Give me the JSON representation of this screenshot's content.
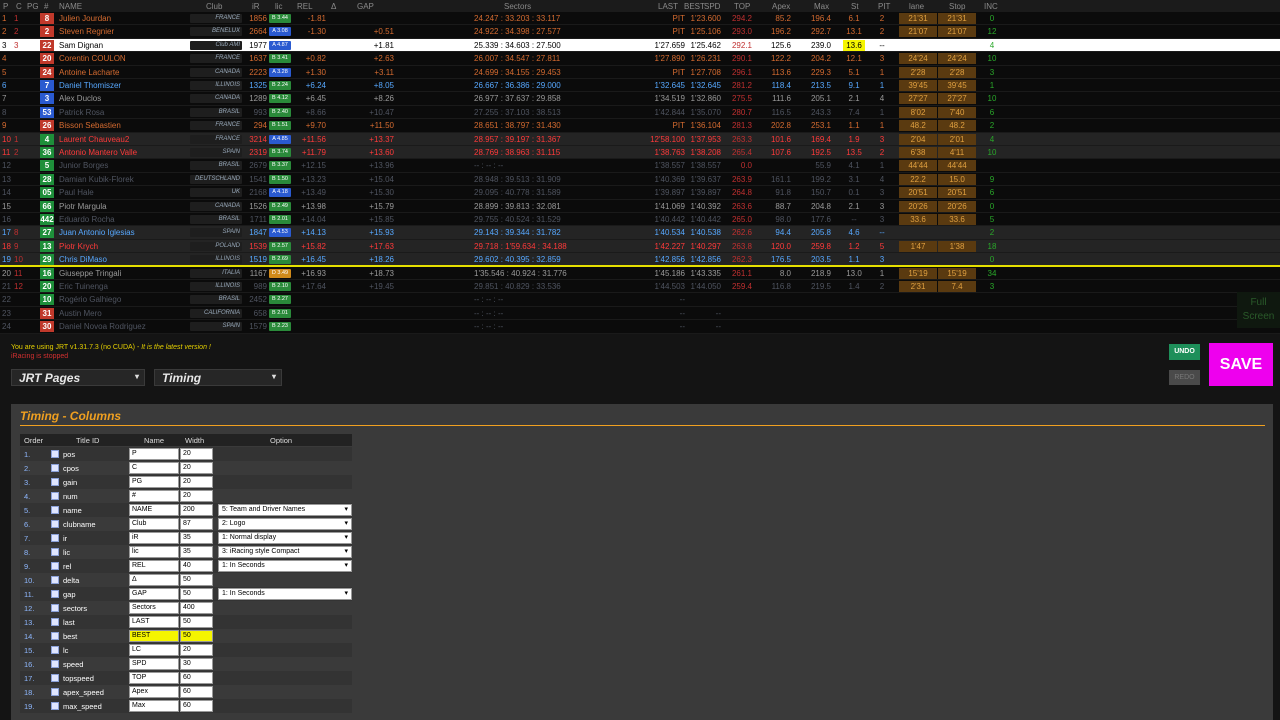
{
  "timing": {
    "headers": {
      "p": "P",
      "c": "C",
      "pg": "PG",
      "num": "#",
      "name": "NAME",
      "club": "Club",
      "ir": "iR",
      "lic": "lic",
      "rel": "REL",
      "delta": "Δ",
      "gap": "GAP",
      "sectors": "Sectors",
      "last": "LAST",
      "best": "BEST",
      "spd": "SPD",
      "top": "TOP",
      "apex": "Apex",
      "max": "Max",
      "st": "St",
      "pit": "PIT",
      "lane": "lane",
      "stop": "Stop",
      "inc": "INC"
    },
    "rows": [
      {
        "p": "1",
        "c": "1",
        "pg": "",
        "num": "8",
        "name": "Julien Jourdan",
        "club": "FRANCE",
        "ir": "1856",
        "lic": "B 3.44",
        "rel": "-1.81",
        "gap": "",
        "sec": "24.247 : 33.203 : 33.117",
        "last": "PIT",
        "best": "1'23.600",
        "top": "294.2",
        "apex": "85.2",
        "max": "196.4",
        "st": "6.1",
        "pit": "2",
        "lane": "21'31",
        "stop": "21'31",
        "inc": "0",
        "style": "orange",
        "numbg": "#c0392b"
      },
      {
        "p": "2",
        "c": "2",
        "pg": "",
        "num": "2",
        "name": "Steven Regnier",
        "club": "BENELUX",
        "ir": "2664",
        "lic": "A 3.08",
        "rel": "-1.30",
        "gap": "+0.51",
        "sec": "24.922 : 34.398 : 27.577",
        "last": "PIT",
        "best": "1'25.106",
        "top": "293.0",
        "apex": "196.2",
        "max": "292.7",
        "st": "13.1",
        "pit": "2",
        "lane": "21'07",
        "stop": "21'07",
        "inc": "12",
        "style": "orange",
        "numbg": "#c0392b"
      },
      {
        "p": "3",
        "c": "3",
        "pg": "",
        "num": "22",
        "name": "Sam Dignan",
        "club": "Club AMI",
        "ir": "1977",
        "lic": "A 4.87",
        "rel": "",
        "gap": "+1.81",
        "sec": "25.339 : 34.603 : 27.500",
        "last": "1'27.659",
        "best": "1'25.462",
        "top": "292.1",
        "apex": "125.6",
        "max": "239.0",
        "st": "13.6",
        "pit": "--",
        "lane": "",
        "stop": "",
        "inc": "4",
        "style": "me",
        "numbg": "#c0392b"
      },
      {
        "p": "4",
        "c": "",
        "pg": "",
        "num": "20",
        "name": "Corentin COULON",
        "club": "FRANCE",
        "ir": "1637",
        "lic": "B 3.41",
        "rel": "+0.82",
        "gap": "+2.63",
        "sec": "26.007 : 34.547 : 27.811",
        "last": "1'27.890",
        "best": "1'26.231",
        "top": "290.1",
        "apex": "122.2",
        "max": "204.2",
        "st": "12.1",
        "pit": "3",
        "lane": "24'24",
        "stop": "24'24",
        "inc": "10",
        "style": "orange",
        "numbg": "#c0392b"
      },
      {
        "p": "5",
        "c": "",
        "pg": "",
        "num": "24",
        "name": "Antoine Lacharte",
        "club": "CANADA",
        "ir": "2223",
        "lic": "A 3.28",
        "rel": "+1.30",
        "gap": "+3.11",
        "sec": "24.699 : 34.155 : 29.453",
        "last": "PIT",
        "best": "1'27.708",
        "top": "296.1",
        "apex": "113.6",
        "max": "229.3",
        "st": "5.1",
        "pit": "1",
        "lane": "2'28",
        "stop": "2'28",
        "inc": "3",
        "style": "orange",
        "numbg": "#c0392b"
      },
      {
        "p": "6",
        "c": "",
        "pg": "",
        "num": "7",
        "name": "Daniel Thomiszer",
        "club": "ILLINOIS",
        "ir": "1325",
        "lic": "B 2.24",
        "rel": "+6.24",
        "gap": "+8.05",
        "sec": "26.667 : 36.386 : 29.000",
        "last": "1'32.645",
        "best": "1'32.645",
        "top": "281.2",
        "apex": "118.4",
        "max": "213.5",
        "st": "9.1",
        "pit": "1",
        "lane": "39'45",
        "stop": "39'45",
        "inc": "1",
        "style": "blue",
        "numbg": "#2a5ad0"
      },
      {
        "p": "7",
        "c": "",
        "pg": "",
        "num": "3",
        "name": "Alex Duclos",
        "club": "CANADA",
        "ir": "1289",
        "lic": "B 4.12",
        "rel": "+6.45",
        "gap": "+8.26",
        "sec": "26.977 : 37.637 : 29.858",
        "last": "1'34.519",
        "best": "1'32.860",
        "top": "275.5",
        "apex": "111.6",
        "max": "205.1",
        "st": "2.1",
        "pit": "4",
        "lane": "27'27",
        "stop": "27'27",
        "inc": "10",
        "style": "dark",
        "numbg": "#2a5ad0"
      },
      {
        "p": "8",
        "c": "",
        "pg": "",
        "num": "53",
        "name": "Patrick Rosa",
        "club": "BRASIL",
        "ir": "993",
        "lic": "B 2.40",
        "rel": "+8.66",
        "gap": "+10.47",
        "sec": "27.255 : 37.103 : 38.513",
        "last": "1'42.844",
        "best": "1'35.070",
        "top": "280.7",
        "apex": "116.5",
        "max": "243.3",
        "st": "7.4",
        "pit": "1",
        "lane": "8'02",
        "stop": "7'40",
        "inc": "6",
        "style": "dim",
        "numbg": "#2a5ad0"
      },
      {
        "p": "9",
        "c": "",
        "pg": "",
        "num": "26",
        "name": "Bisson Sebastien",
        "club": "FRANCE",
        "ir": "294",
        "lic": "B 1.51",
        "rel": "+9.70",
        "gap": "+11.50",
        "sec": "28.651 : 38.797 : 31.430",
        "last": "PIT",
        "best": "1'36.104",
        "top": "281.3",
        "apex": "202.8",
        "max": "253.1",
        "st": "1.1",
        "pit": "1",
        "lane": "48.2",
        "stop": "48.2",
        "inc": "2",
        "style": "orange",
        "numbg": "#c0392b"
      },
      {
        "p": "10",
        "c": "1",
        "pg": "",
        "num": "4",
        "name": "Laurent Chauveau2",
        "club": "FRANCE",
        "ir": "3214",
        "lic": "A 4.85",
        "rel": "+11.56",
        "gap": "+13.37",
        "sec": "28.957 : 39.197 : 31.367",
        "last": "12'58.100",
        "best": "1'37.953",
        "top": "263.3",
        "apex": "101.6",
        "max": "169.4",
        "st": "1.9",
        "pit": "3",
        "lane": "2'04",
        "stop": "2'01",
        "inc": "4",
        "style": "red",
        "numbg": "#1e8f3a",
        "hl": true
      },
      {
        "p": "11",
        "c": "2",
        "pg": "",
        "num": "36",
        "name": "Antonio Mantero Valle",
        "club": "SPAIN",
        "ir": "2319",
        "lic": "B 3.74",
        "rel": "+11.79",
        "gap": "+13.60",
        "sec": "28.769 : 38.963 : 31.115",
        "last": "1'38.763",
        "best": "1'38.208",
        "top": "265.4",
        "apex": "107.6",
        "max": "192.5",
        "st": "13.5",
        "pit": "2",
        "lane": "6'38",
        "stop": "4'11",
        "inc": "10",
        "style": "red",
        "numbg": "#1e8f3a",
        "hl": true
      },
      {
        "p": "12",
        "c": "",
        "pg": "",
        "num": "5",
        "name": "Junior Borges",
        "club": "BRASIL",
        "ir": "2679",
        "lic": "B 3.37",
        "rel": "+12.15",
        "gap": "+13.96",
        "sec": "-- : -- : --",
        "last": "1'38.557",
        "best": "1'38.557",
        "top": "0.0",
        "apex": "",
        "max": "55.9",
        "st": "4.1",
        "pit": "1",
        "lane": "44'44",
        "stop": "44'44",
        "inc": "",
        "style": "dim",
        "numbg": "#1e8f3a"
      },
      {
        "p": "13",
        "c": "",
        "pg": "",
        "num": "28",
        "name": "Damian Kubik-Florek",
        "club": "DEUTSCHLAND",
        "ir": "1541",
        "lic": "B 1.50",
        "rel": "+13.23",
        "gap": "+15.04",
        "sec": "28.948 : 39.513 : 31.909",
        "last": "1'40.369",
        "best": "1'39.637",
        "top": "263.9",
        "apex": "161.1",
        "max": "199.2",
        "st": "3.1",
        "pit": "4",
        "lane": "22.2",
        "stop": "15.0",
        "inc": "9",
        "style": "dim",
        "numbg": "#1e8f3a"
      },
      {
        "p": "14",
        "c": "",
        "pg": "",
        "num": "05",
        "name": "Paul Hale",
        "club": "UK",
        "ir": "2168",
        "lic": "A 4.18",
        "rel": "+13.49",
        "gap": "+15.30",
        "sec": "29.095 : 40.778 : 31.589",
        "last": "1'39.897",
        "best": "1'39.897",
        "top": "264.8",
        "apex": "91.8",
        "max": "150.7",
        "st": "0.1",
        "pit": "3",
        "lane": "20'51",
        "stop": "20'51",
        "inc": "6",
        "style": "dim",
        "numbg": "#1e8f3a"
      },
      {
        "p": "15",
        "c": "",
        "pg": "",
        "num": "66",
        "name": "Piotr Margula",
        "club": "CANADA",
        "ir": "1526",
        "lic": "B 2.49",
        "rel": "+13.98",
        "gap": "+15.79",
        "sec": "28.899 : 39.813 : 32.081",
        "last": "1'41.069",
        "best": "1'40.392",
        "top": "263.6",
        "apex": "88.7",
        "max": "204.8",
        "st": "2.1",
        "pit": "3",
        "lane": "20'26",
        "stop": "20'26",
        "inc": "0",
        "style": "dark",
        "numbg": "#1e8f3a"
      },
      {
        "p": "16",
        "c": "",
        "pg": "",
        "num": "442",
        "name": "Eduardo Rocha",
        "club": "BRASIL",
        "ir": "1711",
        "lic": "B 2.01",
        "rel": "+14.04",
        "gap": "+15.85",
        "sec": "29.755 : 40.524 : 31.529",
        "last": "1'40.442",
        "best": "1'40.442",
        "top": "265.0",
        "apex": "98.0",
        "max": "177.6",
        "st": "--",
        "pit": "3",
        "lane": "33.6",
        "stop": "33.6",
        "inc": "5",
        "style": "dim",
        "numbg": "#1e8f3a"
      },
      {
        "p": "17",
        "c": "8",
        "pg": "",
        "num": "27",
        "name": "Juan Antonio Iglesias",
        "club": "SPAIN",
        "ir": "1847",
        "lic": "A 4.53",
        "rel": "+14.13",
        "gap": "+15.93",
        "sec": "29.143 : 39.344 : 31.782",
        "last": "1'40.534",
        "best": "1'40.538",
        "top": "262.6",
        "apex": "94.4",
        "max": "205.8",
        "st": "4.6",
        "pit": "--",
        "lane": "",
        "stop": "",
        "inc": "2",
        "style": "blue",
        "numbg": "#1e8f3a",
        "hl": true
      },
      {
        "p": "18",
        "c": "9",
        "pg": "",
        "num": "13",
        "name": "Piotr Krych",
        "club": "POLAND",
        "ir": "1539",
        "lic": "B 2.57",
        "rel": "+15.82",
        "gap": "+17.63",
        "sec": "29.718 : 1'59.634 : 34.188",
        "last": "1'42.227",
        "best": "1'40.297",
        "top": "263.8",
        "apex": "120.0",
        "max": "259.8",
        "st": "1.2",
        "pit": "5",
        "lane": "1'47",
        "stop": "1'38",
        "inc": "18",
        "style": "red",
        "numbg": "#1e8f3a",
        "hl": true
      },
      {
        "p": "19",
        "c": "10",
        "pg": "",
        "num": "29",
        "name": "Chris DiMaso",
        "club": "ILLINOIS",
        "ir": "1519",
        "lic": "B 2.69",
        "rel": "+16.45",
        "gap": "+18.26",
        "sec": "29.602 : 40.395 : 32.859",
        "last": "1'42.856",
        "best": "1'42.856",
        "top": "262.3",
        "apex": "176.5",
        "max": "203.5",
        "st": "1.1",
        "pit": "3",
        "lane": "",
        "stop": "",
        "inc": "0",
        "style": "blue",
        "numbg": "#1e8f3a",
        "hl": true,
        "yline": true
      },
      {
        "p": "20",
        "c": "11",
        "pg": "",
        "num": "16",
        "name": "Giuseppe Tringali",
        "club": "ITALIA",
        "ir": "1167",
        "lic": "D 3.49",
        "rel": "+16.93",
        "gap": "+18.73",
        "sec": "1'35.546 : 40.924 : 31.776",
        "last": "1'45.186",
        "best": "1'43.335",
        "top": "261.1",
        "apex": "8.0",
        "max": "218.9",
        "st": "13.0",
        "pit": "1",
        "lane": "15'19",
        "stop": "15'19",
        "inc": "34",
        "style": "dark",
        "numbg": "#1e8f3a"
      },
      {
        "p": "21",
        "c": "12",
        "pg": "",
        "num": "20",
        "name": "Eric Tuinenga",
        "club": "ILLINOIS",
        "ir": "989",
        "lic": "B 2.10",
        "rel": "+17.64",
        "gap": "+19.45",
        "sec": "29.851 : 40.829 : 33.536",
        "last": "1'44.503",
        "best": "1'44.050",
        "top": "259.4",
        "apex": "116.8",
        "max": "219.5",
        "st": "1.4",
        "pit": "2",
        "lane": "2'31",
        "stop": "7.4",
        "inc": "3",
        "style": "dim",
        "numbg": "#1e8f3a"
      },
      {
        "p": "22",
        "c": "",
        "pg": "",
        "num": "10",
        "name": "Rogério Galhiego",
        "club": "BRASIL",
        "ir": "2452",
        "lic": "B 2.27",
        "rel": "",
        "gap": "",
        "sec": "-- : -- : --",
        "last": "--",
        "best": "",
        "top": "",
        "apex": "",
        "max": "",
        "st": "",
        "pit": "",
        "lane": "",
        "stop": "",
        "inc": "",
        "style": "dim",
        "numbg": "#1e8f3a"
      },
      {
        "p": "23",
        "c": "",
        "pg": "",
        "num": "31",
        "name": "Austin Mero",
        "club": "CALIFORNIA",
        "ir": "658",
        "lic": "B 2.01",
        "rel": "",
        "gap": "",
        "sec": "-- : -- : --",
        "last": "--",
        "best": "--",
        "top": "",
        "apex": "",
        "max": "",
        "st": "",
        "pit": "",
        "lane": "",
        "stop": "",
        "inc": "",
        "style": "dim",
        "numbg": "#c0392b"
      },
      {
        "p": "24",
        "c": "",
        "pg": "",
        "num": "30",
        "name": "Daniel Novoa Rodriguez",
        "club": "SPAIN",
        "ir": "1579",
        "lic": "B 2.23",
        "rel": "",
        "gap": "",
        "sec": "-- : -- : --",
        "last": "--",
        "best": "--",
        "top": "",
        "apex": "",
        "max": "",
        "st": "",
        "pit": "",
        "lane": "",
        "stop": "",
        "inc": "",
        "style": "dim",
        "numbg": "#c0392b"
      }
    ],
    "fullscreen_label": "Full Screen"
  },
  "panel": {
    "version_text": "You are using JRT v1.31.7.3 (no CUDA) - ",
    "version_latest": "It is the latest version !",
    "status": "iRacing is stopped",
    "pages_dropdown": "JRT Pages",
    "page_selected": "Timing",
    "undo_label": "UNDO",
    "redo_label": "REDO",
    "save_label": "SAVE",
    "editor_title": "Timing - Columns",
    "columns_headers": {
      "order": "Order",
      "title_id": "Title ID",
      "name": "Name",
      "width": "Width",
      "option": "Option"
    },
    "columns": [
      {
        "order": "1.",
        "id": "pos",
        "name": "P",
        "width": "20",
        "option": ""
      },
      {
        "order": "2.",
        "id": "cpos",
        "name": "C",
        "width": "20",
        "option": ""
      },
      {
        "order": "3.",
        "id": "gain",
        "name": "PG",
        "width": "20",
        "option": ""
      },
      {
        "order": "4.",
        "id": "num",
        "name": "#",
        "width": "20",
        "option": ""
      },
      {
        "order": "5.",
        "id": "name",
        "name": "NAME",
        "width": "200",
        "option": "5: Team and Driver Names"
      },
      {
        "order": "6.",
        "id": "clubname",
        "name": "Club",
        "width": "87",
        "option": "2: Logo"
      },
      {
        "order": "7.",
        "id": "ir",
        "name": "iR",
        "width": "35",
        "option": "1: Normal display"
      },
      {
        "order": "8.",
        "id": "lic",
        "name": "lic",
        "width": "35",
        "option": "3: iRacing style Compact"
      },
      {
        "order": "9.",
        "id": "rel",
        "name": "REL",
        "width": "40",
        "option": "1: In Seconds"
      },
      {
        "order": "10.",
        "id": "delta",
        "name": "Δ",
        "width": "50",
        "option": ""
      },
      {
        "order": "11.",
        "id": "gap",
        "name": "GAP",
        "width": "50",
        "option": "1: In Seconds"
      },
      {
        "order": "12.",
        "id": "sectors",
        "name": "Sectors",
        "width": "400",
        "option": ""
      },
      {
        "order": "13.",
        "id": "last",
        "name": "LAST",
        "width": "50",
        "option": ""
      },
      {
        "order": "14.",
        "id": "best",
        "name": "BEST",
        "width": "50",
        "option": "",
        "selected": true
      },
      {
        "order": "15.",
        "id": "lc",
        "name": "LC",
        "width": "20",
        "option": ""
      },
      {
        "order": "16.",
        "id": "speed",
        "name": "SPD",
        "width": "30",
        "option": ""
      },
      {
        "order": "17.",
        "id": "topspeed",
        "name": "TOP",
        "width": "60",
        "option": ""
      },
      {
        "order": "18.",
        "id": "apex_speed",
        "name": "Apex",
        "width": "60",
        "option": ""
      },
      {
        "order": "19.",
        "id": "max_speed",
        "name": "Max",
        "width": "60",
        "option": ""
      }
    ]
  }
}
